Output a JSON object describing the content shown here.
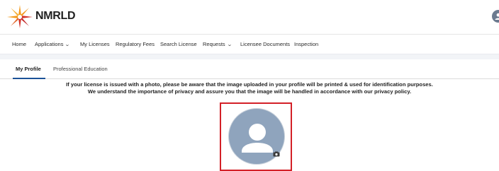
{
  "brand": {
    "name": "NMRLD"
  },
  "nav": {
    "items": [
      {
        "label": "Home",
        "dropdown": false
      },
      {
        "label": "Applications",
        "dropdown": true
      },
      {
        "label": "My Licenses",
        "dropdown": false
      },
      {
        "label": "Regulatory Fees",
        "dropdown": false
      },
      {
        "label": "Search License",
        "dropdown": false
      },
      {
        "label": "Requests",
        "dropdown": true
      },
      {
        "label": "Licensee Documents",
        "dropdown": false
      },
      {
        "label": "Inspection",
        "dropdown": false
      }
    ]
  },
  "tabs": [
    {
      "label": "My Profile",
      "active": true
    },
    {
      "label": "Professional Education",
      "active": false
    }
  ],
  "notice": {
    "line1": "If your license is issued with a photo, please be aware that the image uploaded in your profile will be printed & used for identification purposes.",
    "line2": "We understand the importance of privacy and assure you that the image will be handled in accordance with our privacy policy."
  },
  "icons": {
    "logo": "sunburst-logo-icon",
    "user": "user-avatar-icon",
    "photo": "profile-placeholder-icon",
    "camera": "camera-icon",
    "chevron": "chevron-down-icon"
  },
  "colors": {
    "accent": "#1b5297",
    "highlight_border": "#d32027",
    "avatar_bg": "#8fa4bd",
    "logo_orange": "#f39a1e",
    "logo_red": "#d4352b"
  }
}
